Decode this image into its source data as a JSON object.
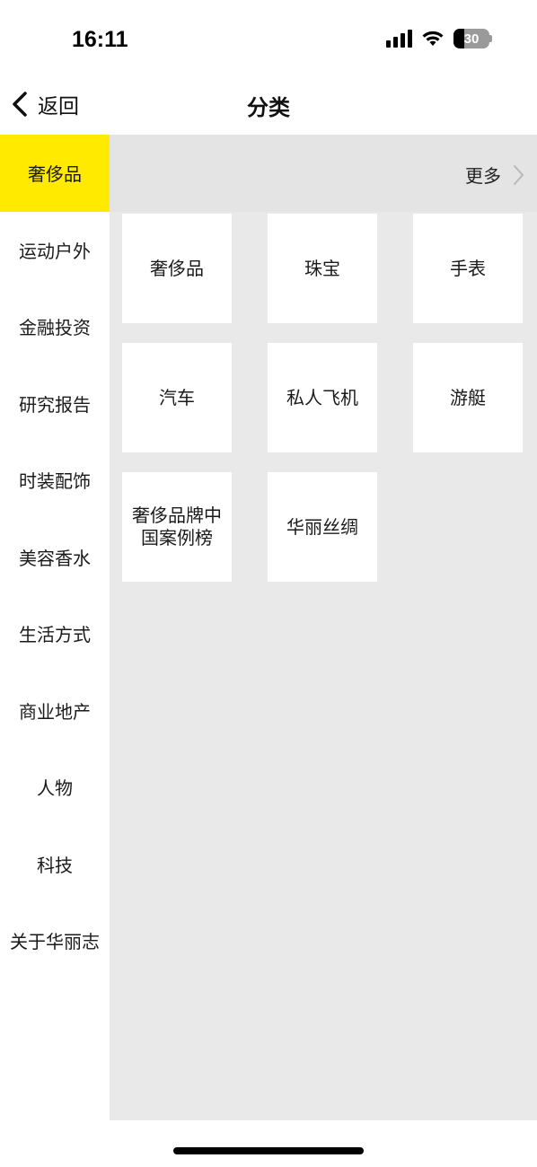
{
  "status_bar": {
    "time": "16:11",
    "battery_level": "30",
    "signal_icon": "signal-bars-icon",
    "wifi_icon": "wifi-icon"
  },
  "nav": {
    "back_label": "返回",
    "title": "分类"
  },
  "sidebar": {
    "active_color": "#ffea00",
    "items": [
      {
        "label": "奢侈品",
        "active": true
      },
      {
        "label": "运动户外"
      },
      {
        "label": "金融投资"
      },
      {
        "label": "研究报告"
      },
      {
        "label": "时装配饰"
      },
      {
        "label": "美容香水"
      },
      {
        "label": "生活方式"
      },
      {
        "label": "商业地产"
      },
      {
        "label": "人物"
      },
      {
        "label": "科技"
      },
      {
        "label": "关于华丽志"
      }
    ]
  },
  "content": {
    "more_label": "更多",
    "tiles": [
      {
        "label": "奢侈品"
      },
      {
        "label": "珠宝"
      },
      {
        "label": "手表"
      },
      {
        "label": "汽车"
      },
      {
        "label": "私人飞机"
      },
      {
        "label": "游艇"
      },
      {
        "label": "奢侈品牌中国案例榜"
      },
      {
        "label": "华丽丝绸"
      }
    ]
  }
}
